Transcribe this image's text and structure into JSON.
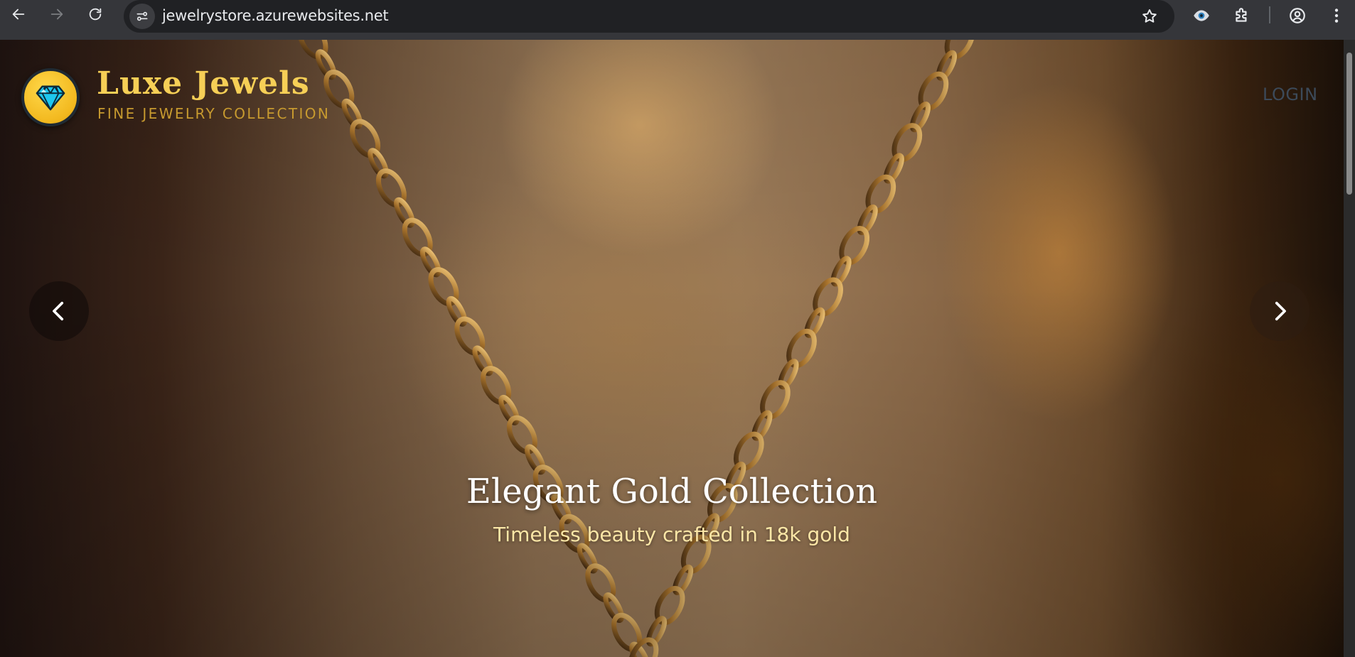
{
  "browser": {
    "url": "jewelrystore.azurewebsites.net",
    "icons": [
      "back-icon",
      "forward-icon",
      "reload-icon",
      "site-info-icon",
      "bookmark-star-icon",
      "eye-extension-icon",
      "extensions-puzzle-icon",
      "profile-icon",
      "menu-dots-icon"
    ]
  },
  "header": {
    "brand_name": "Luxe Jewels",
    "brand_tagline": "FINE JEWELRY COLLECTION",
    "login_label": "LOGIN",
    "logo_icon": "diamond-icon"
  },
  "hero": {
    "slide_title": "Elegant Gold Collection",
    "slide_subtitle": "Timeless beauty crafted in 18k gold",
    "prev_icon": "chevron-left-icon",
    "next_icon": "chevron-right-icon"
  },
  "colors": {
    "brand_gold": "#f6cf56",
    "tagline_gold": "#c79a2f",
    "subtitle_cream": "#fbe6a6",
    "login_text": "#3c4a5a",
    "chrome_bg": "#35363a",
    "omnibox_bg": "#202124"
  }
}
